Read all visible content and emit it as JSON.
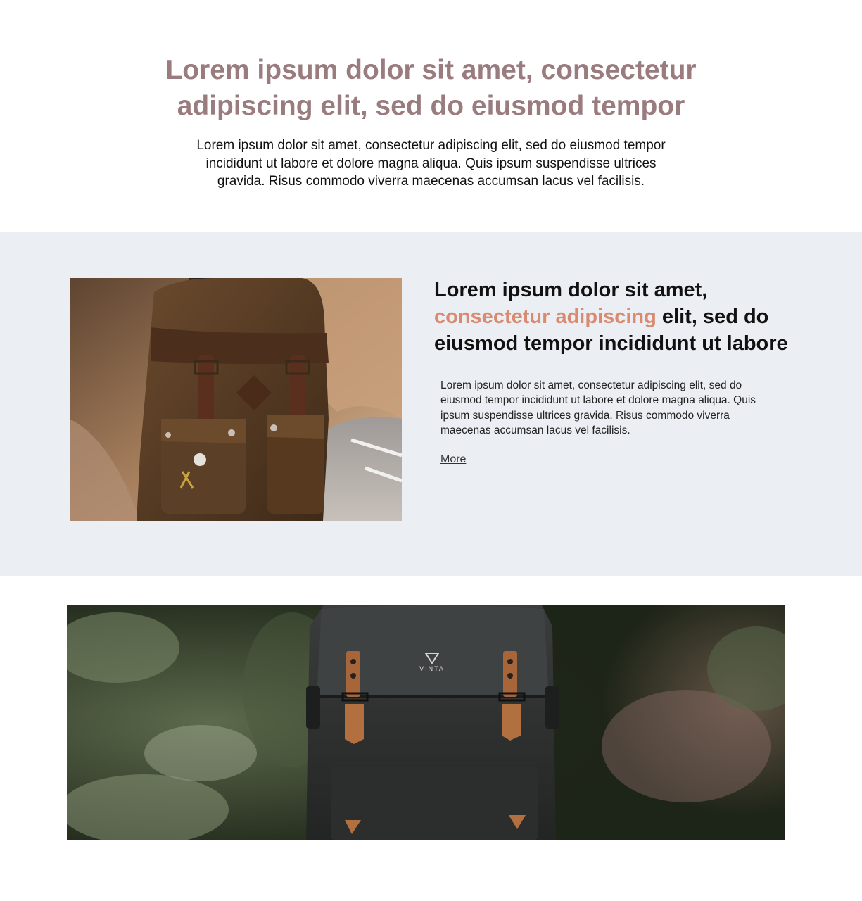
{
  "intro": {
    "title_line1": "Lorem ipsum dolor sit amet, consectetur",
    "title_line2": "adipiscing elit, sed do eiusmod tempor",
    "text_line1": "Lorem ipsum dolor sit amet, consectetur adipiscing elit, sed do eiusmod tempor",
    "text_line2": "incididunt ut labore et dolore magna aliqua. Quis ipsum suspendisse ultrices",
    "text_line3": "gravida. Risus commodo viverra maecenas accumsan lacus vel facilisis."
  },
  "feature": {
    "heading_start": "Lorem ipsum dolor sit amet,",
    "heading_accent": "consectetur adipiscing",
    "heading_mid": " elit, sed do",
    "heading_end": "eiusmod tempor incididunt ut labore",
    "text_line1": "Lorem ipsum dolor sit amet, consectetur adipiscing elit, sed do",
    "text_line2": "eiusmod tempor incididunt ut labore et dolore magna aliqua. Quis",
    "text_line3": "ipsum suspendisse ultrices gravida. Risus commodo viverra",
    "text_line4": "maecenas accumsan lacus vel facilisis.",
    "more_label": "More",
    "photo_icon": "brown-canvas-backpack-photo"
  },
  "banner": {
    "brand_label": "VINTA",
    "photo_icon": "black-backpack-photo"
  },
  "colors": {
    "intro_title": "#9a7c7f",
    "accent": "#d98b72",
    "band_background": "#ebeef2"
  }
}
